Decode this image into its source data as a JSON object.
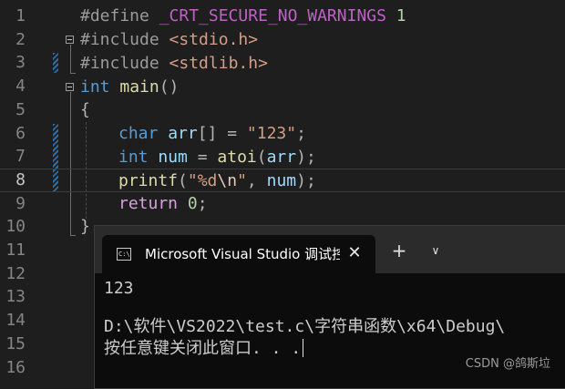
{
  "editor": {
    "line_numbers": [
      "1",
      "2",
      "3",
      "4",
      "5",
      "6",
      "7",
      "8",
      "9",
      "10",
      "11",
      "12",
      "13",
      "14",
      "15",
      "16"
    ],
    "active_line": "8",
    "lines": {
      "l1": {
        "kw": "#define",
        "macro": "_CRT_SECURE_NO_WARNINGS",
        "num": "1"
      },
      "l2": {
        "kw": "#include",
        "incl": "<stdio.h>"
      },
      "l3": {
        "kw": "#include",
        "incl": "<stdlib.h>"
      },
      "l4": {
        "type": "int",
        "fn": "main",
        "rest": "()"
      },
      "l5": {
        "brace": "{"
      },
      "l6": {
        "type": "char",
        "var": "arr",
        "mid": "[] = ",
        "str": "\"123\"",
        "end": ";"
      },
      "l7": {
        "type": "int",
        "var": "num",
        "mid": " = ",
        "fn": "atoi",
        "open": "(",
        "arg": "arr",
        "end": ");"
      },
      "l8": {
        "fn": "printf",
        "open": "(",
        "str1": "\"%d",
        "esc": "\\n",
        "str2": "\"",
        "sep": ", ",
        "arg": "num",
        "end": ");"
      },
      "l9": {
        "ctl": "return",
        "num": "0",
        "end": ";"
      },
      "l10": {
        "brace": "}"
      }
    }
  },
  "terminal": {
    "tab_title": "Microsoft Visual Studio 调试控制台",
    "icon_label": "C:\\",
    "close_glyph": "✕",
    "new_tab_glyph": "+",
    "dropdown_glyph": "∨",
    "output": {
      "line1": "123",
      "line2": "D:\\软件\\VS2022\\test.c\\字符串函数\\x64\\Debug\\",
      "line3": "按任意键关闭此窗口. . ."
    }
  },
  "watermark": "CSDN @鸽斯垃"
}
